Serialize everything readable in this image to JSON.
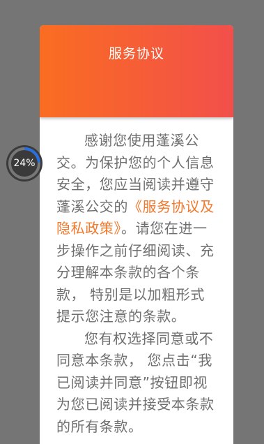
{
  "dialog": {
    "title": "服务协议",
    "paragraph1_prefix": "感谢您使用蓬溪公交。为保护您的个人信息安全，您应当阅读并遵守蓬溪公交的",
    "agreement_link": "《服务协议及隐私政策》",
    "paragraph1_suffix": "。请您在进一步操作之前仔细阅读、充分理解本条款的各个条款， 特别是以加粗形式提示您注意的条款。",
    "paragraph2": "您有权选择同意或不同意本条款， 您点击“我已阅读并同意”按钮即视为您已阅读并接受本条款的所有条款。"
  },
  "progress": {
    "label": "24%",
    "fraction": 0.24
  },
  "colors": {
    "backdrop": "#757575",
    "header_gradient_start": "#fa6d21",
    "header_gradient_end": "#f24f4b",
    "link": "#f2782b",
    "body_text": "#6f6f6f",
    "progress_arc": "#2a6fe0"
  }
}
